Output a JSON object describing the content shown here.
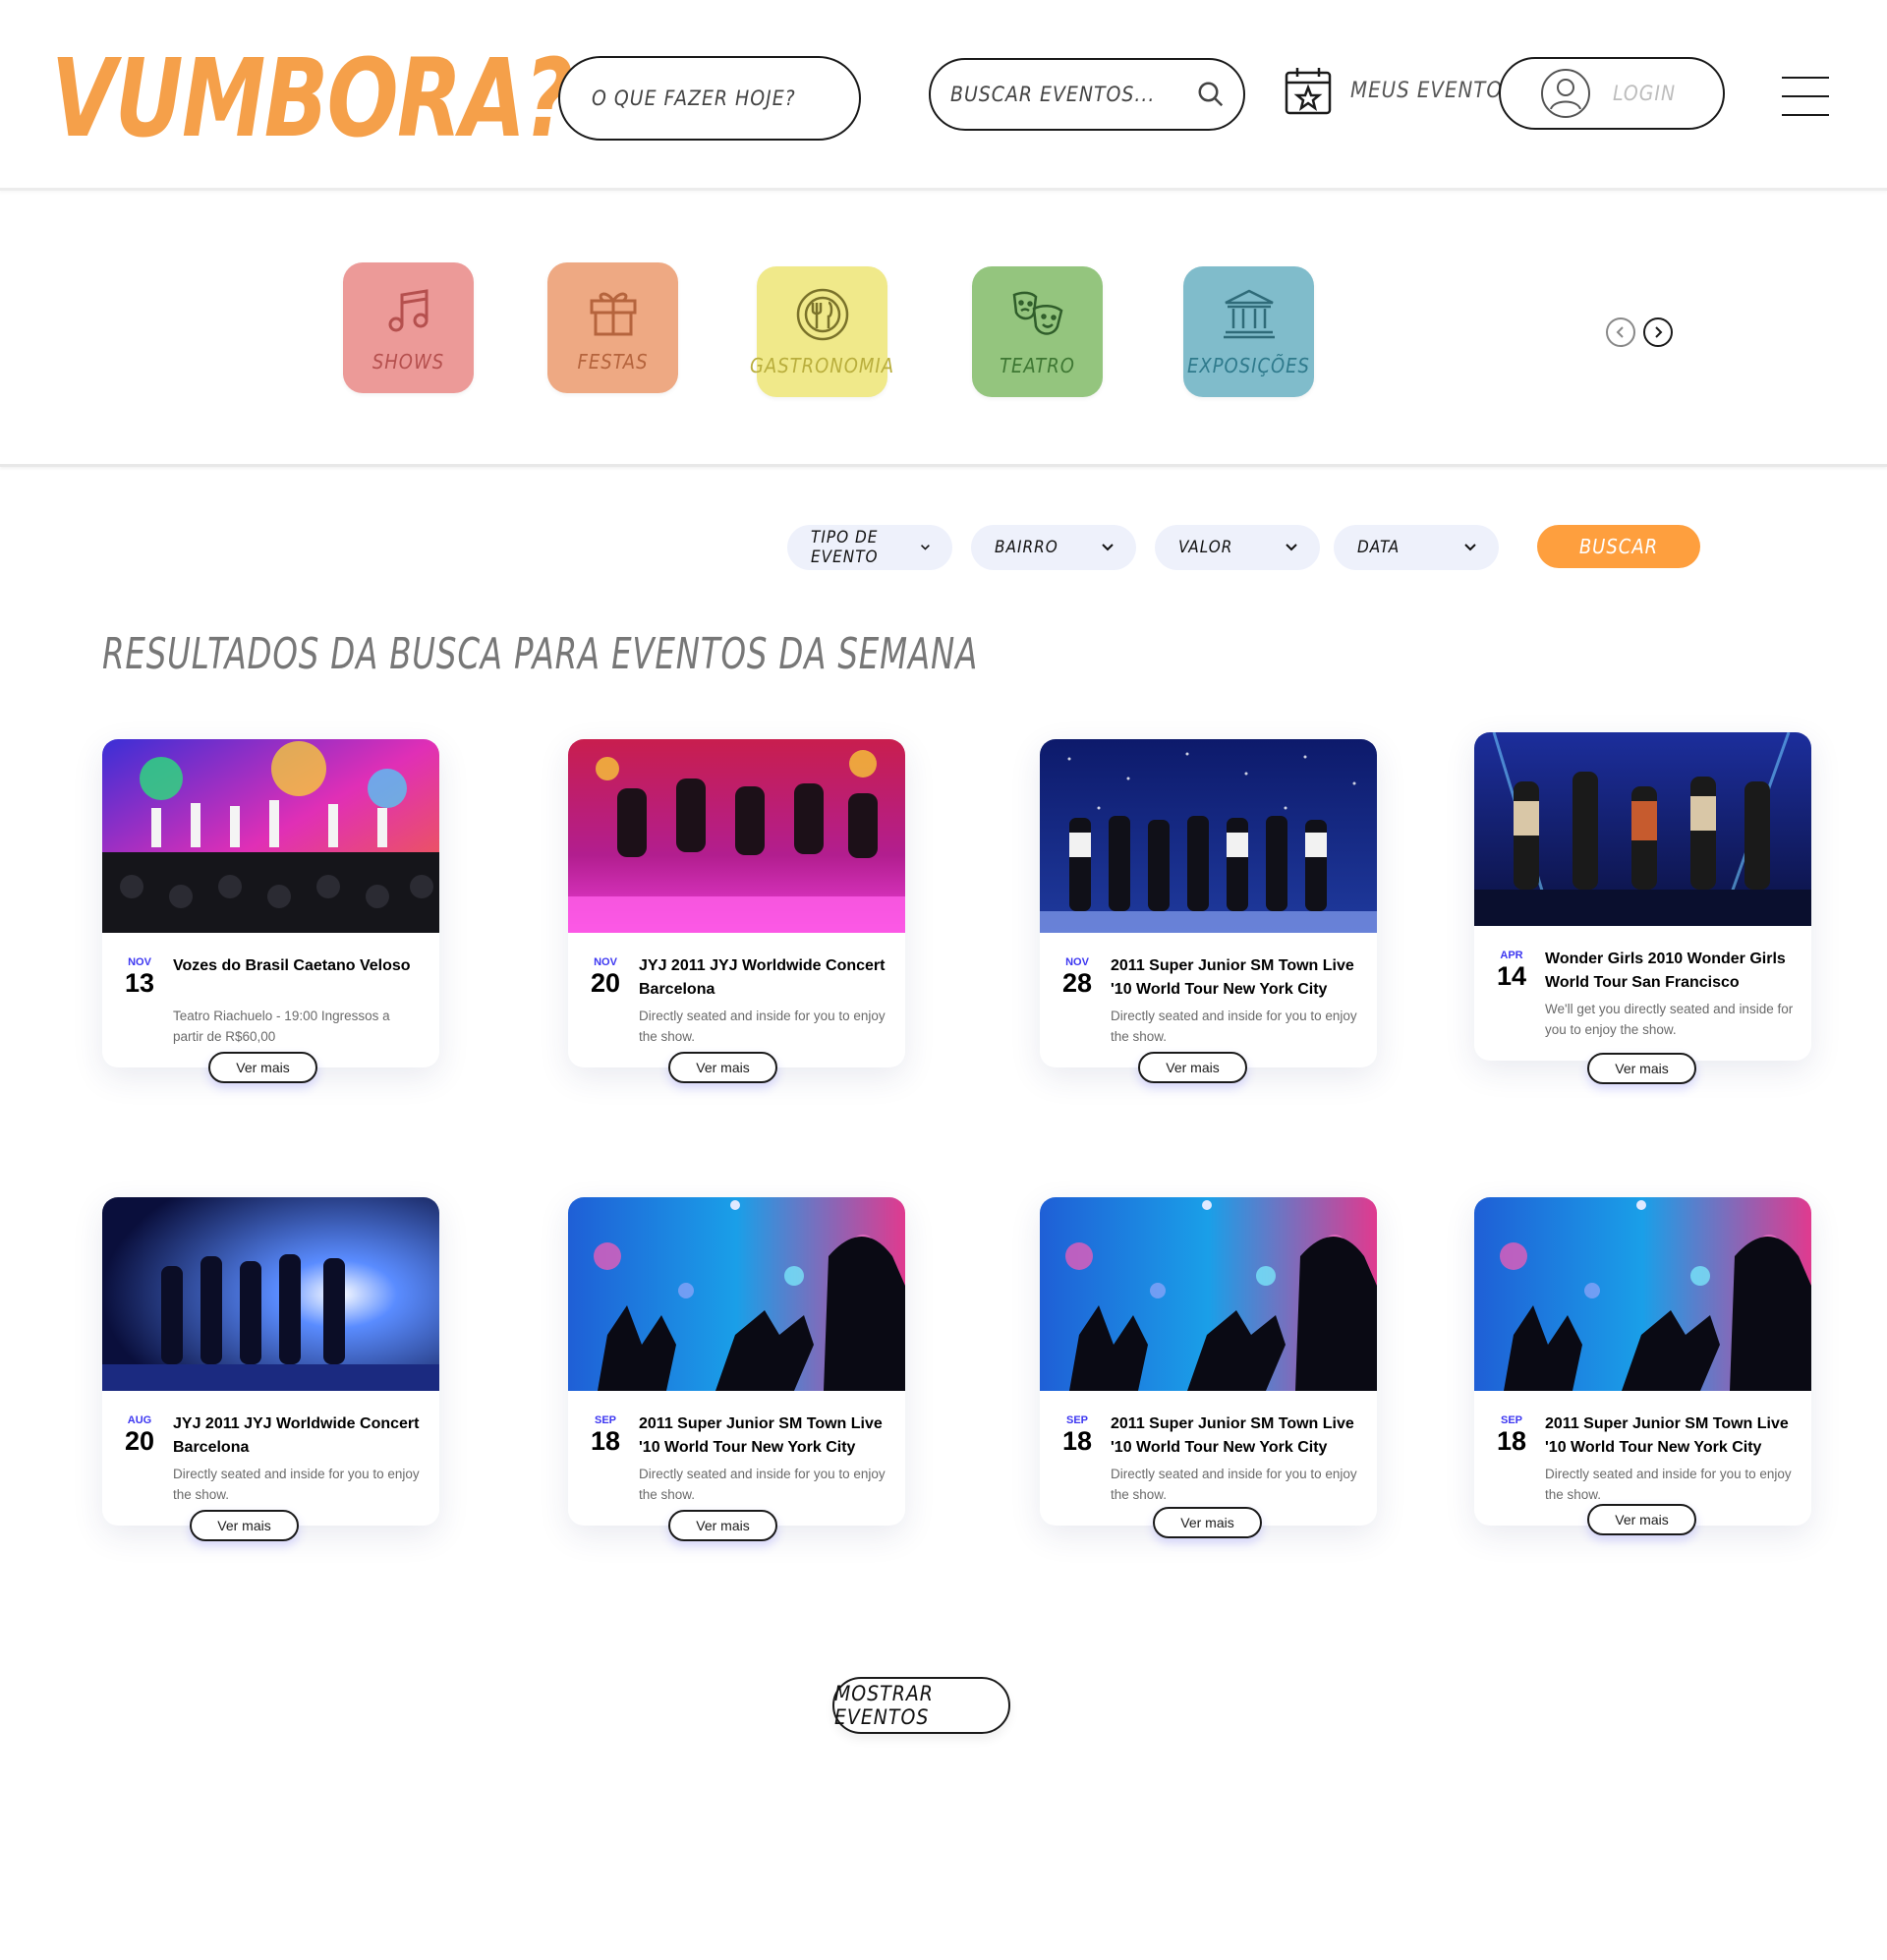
{
  "header": {
    "logo": "VUMBORA?",
    "today_label": "O QUE FAZER HOJE?",
    "search_placeholder": "BUSCAR EVENTOS...",
    "my_events_label": "MEUS EVENTOS",
    "login_label": "LOGIN"
  },
  "categories": [
    {
      "label": "SHOWS",
      "icon": "music-note-icon",
      "bg": "#ec9a98",
      "fg": "#b5504e"
    },
    {
      "label": "FESTAS",
      "icon": "gift-icon",
      "bg": "#eea983",
      "fg": "#b5643d"
    },
    {
      "label": "GASTRONOMIA",
      "icon": "cutlery-icon",
      "bg": "#f0e98a",
      "fg": "#b9ae3d"
    },
    {
      "label": "TEATRO",
      "icon": "theater-masks-icon",
      "bg": "#94c57e",
      "fg": "#3e7733"
    },
    {
      "label": "EXPOSIÇÕES",
      "icon": "museum-icon",
      "bg": "#80bccb",
      "fg": "#2f7a8c"
    }
  ],
  "filters": {
    "type": "TIPO DE EVENTO",
    "neighborhood": "BAIRRO",
    "price": "VALOR",
    "date": "DATA",
    "submit": "BUSCAR"
  },
  "results_title": "RESULTADOS DA BUSCA PARA EVENTOS DA SEMANA",
  "cards": [
    {
      "month": "NOV",
      "day": "13",
      "title": "Vozes do Brasil Caetano Veloso",
      "desc": "Teatro Riachuelo - 19:00 Ingressos a partir de R$60,00",
      "button": "Ver mais",
      "image": "concert-stage-colorful"
    },
    {
      "month": "NOV",
      "day": "20",
      "title": "JYJ 2011 JYJ Worldwide Concert Barcelona",
      "desc": "Directly seated and inside for you to enjoy the show.",
      "button": "Ver mais",
      "image": "concert-jumping-pink"
    },
    {
      "month": "NOV",
      "day": "28",
      "title": "2011 Super Junior SM Town Live '10 World Tour New York City",
      "desc": "Directly seated and inside for you to enjoy the show.",
      "button": "Ver mais",
      "image": "concert-group-blue"
    },
    {
      "month": "APR",
      "day": "14",
      "title": "Wonder Girls 2010 Wonder Girls World Tour San Francisco",
      "desc": "We'll get you directly seated and inside for you to enjoy the show.",
      "button": "Ver mais",
      "image": "concert-dancing-stage"
    },
    {
      "month": "AUG",
      "day": "20",
      "title": "JYJ 2011 JYJ Worldwide Concert Barcelona",
      "desc": "Directly seated and inside for you to enjoy the show.",
      "button": "Ver mais",
      "image": "concert-silhouettes-blue"
    },
    {
      "month": "SEP",
      "day": "18",
      "title": "2011 Super Junior SM Town Live '10 World Tour New York City",
      "desc": "Directly seated and inside for you to enjoy the show.",
      "button": "Ver mais",
      "image": "concert-hand-hearts"
    },
    {
      "month": "SEP",
      "day": "18",
      "title": "2011 Super Junior SM Town Live '10 World Tour New York City",
      "desc": "Directly seated and inside for you to enjoy the show.",
      "button": "Ver mais",
      "image": "concert-hand-hearts"
    },
    {
      "month": "SEP",
      "day": "18",
      "title": "2011 Super Junior SM Town Live '10 World Tour New York City",
      "desc": "Directly seated and inside for you to enjoy the show.",
      "button": "Ver mais",
      "image": "concert-hand-hearts"
    }
  ],
  "show_more": "MOSTRAR EVENTOS"
}
